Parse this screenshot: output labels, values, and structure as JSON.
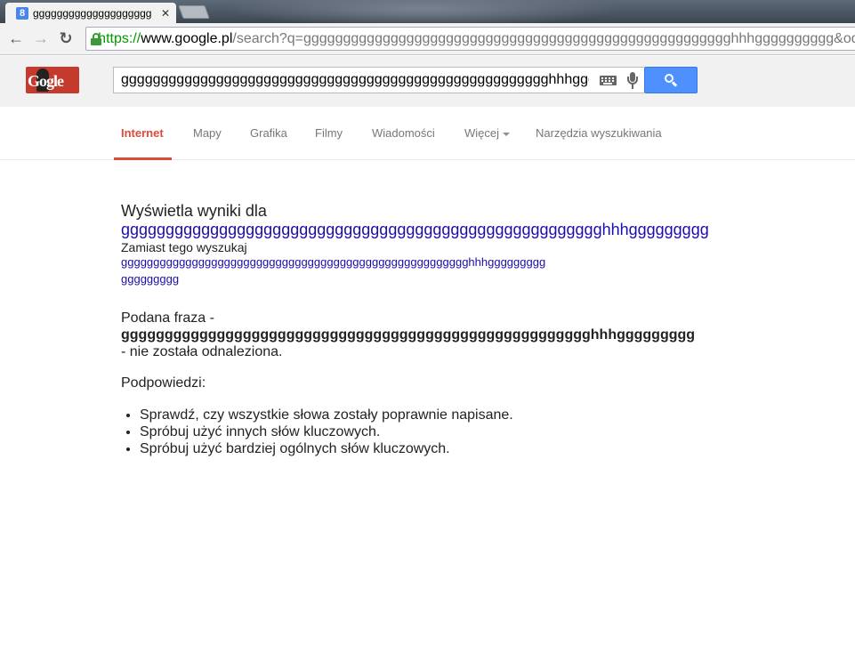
{
  "browser": {
    "tab_title": "gggggggggggggggggggg",
    "tab_favicon": "8",
    "tab_close": "✕",
    "url_scheme": "https://",
    "url_host": "www.google.pl",
    "url_rest": "/search?q=gggggggggggggggggggggggggggggggggggggggggggggggggggggghhhgggggggggg&oq=",
    "back": "←",
    "forward": "→",
    "reload": "↻"
  },
  "header": {
    "logo_text": "Gogle",
    "search_value": "gggggggggggggggggggggggggggggggggggggggggggggggggggggghhhggggggggg"
  },
  "navtabs": {
    "internet": "Internet",
    "mapy": "Mapy",
    "grafika": "Grafika",
    "filmy": "Filmy",
    "wiadomosci": "Wiadomości",
    "wiecej": "Więcej",
    "narzedzia": "Narzędzia wyszukiwania"
  },
  "results": {
    "show_label": "Wyświetla wyniki dla",
    "show_link": "gggggggggggggggggggggggggggggggggggggggggggggggggggggghhhggggggggg",
    "instead_label": "Zamiast tego wyszukaj",
    "instead_link_line1": "gggggggggggggggggggggggggggggggggggggggggggggggggggggghhhggggggggg",
    "instead_link_line2": "ggggggggg",
    "phrase_prefix": "Podana fraza -",
    "phrase_bold": "gggggggggggggggggggggggggggggggggggggggggggggggggggggghhhggggggggg",
    "phrase_suffix": "- nie została odnaleziona.",
    "suggest_title": "Podpowiedzi:",
    "suggestions": [
      "Sprawdź, czy wszystkie słowa zostały poprawnie napisane.",
      "Spróbuj użyć innych słów kluczowych.",
      "Spróbuj użyć bardziej ogólnych słów kluczowych."
    ]
  },
  "colors": {
    "accent_red": "#dd4b39",
    "link_blue": "#1a0dab",
    "search_blue": "#4d90fe",
    "url_green": "#009a00"
  }
}
